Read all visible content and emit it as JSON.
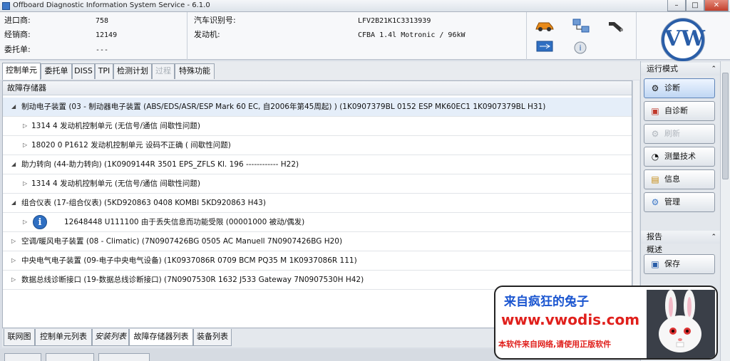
{
  "window": {
    "title": "Offboard Diagnostic Information System Service - 6.1.0"
  },
  "header": {
    "left": [
      {
        "label": "进口商:",
        "value": "758"
      },
      {
        "label": "经销商:",
        "value": "12149"
      },
      {
        "label": "委托单:",
        "value": "---"
      }
    ],
    "mid": [
      {
        "label": "汽车识别号:",
        "value": "LFV2B21K1C3313939"
      },
      {
        "label": "发动机:",
        "value": "CFBA 1.4l Motronic / 96kW"
      }
    ]
  },
  "tabs": [
    {
      "label": "控制单元",
      "state": "active"
    },
    {
      "label": "委托单",
      "state": "normal"
    },
    {
      "label": "DISS",
      "state": "normal"
    },
    {
      "label": "TPI",
      "state": "normal"
    },
    {
      "label": "检测计划",
      "state": "normal"
    },
    {
      "label": "过程",
      "state": "disabled"
    },
    {
      "label": "特殊功能",
      "state": "normal"
    }
  ],
  "fault_memory": {
    "title": "故障存储器",
    "rows": [
      {
        "text": "制动电子装置 (03 - 制动器电子装置 (ABS/EDS/ASR/ESP Mark 60 EC, 自2006年第45周起) ) (1K0907379BL    0152    ESP MK60EC1      1K0907379BL    H31)"
      },
      {
        "text": "1314    4    发动机控制单元  (无信号/通信    间歇性问题)"
      },
      {
        "text": "18020    0    P1612    发动机控制单元 设码不正确  (    间歇性问题)"
      },
      {
        "text": "助力转向 (44-助力转向) (1K0909144R      3501     EPS_ZFLS Kl. 196        ------------     H22)"
      },
      {
        "text": "1314    4    发动机控制单元  (无信号/通信    间歇性问题)"
      },
      {
        "text": "组合仪表 (17-组合仪表) (5KD920863       0408    KOMBI               5KD920863       H43)"
      },
      {
        "text": "12648448    U111100    由于丢失信息而功能受限  (00001000    被动/偶发)"
      },
      {
        "text": "空调/暖风电子装置 (08 - Climatic) (7N0907426BG    0505    AC Manuell       7N0907426BG    H20)"
      },
      {
        "text": "中央电气电子装置 (09-电子中央电气设备) (1K0937086R     0709    BCM PQ35  M      1K0937086R     111)"
      },
      {
        "text": "数据总线诊断接口 (19-数据总线诊断接口) (7N0907530R     1632    J533   Gateway    7N0907530H     H42)"
      }
    ]
  },
  "bottom_tabs": [
    {
      "label": "联网图",
      "state": "normal"
    },
    {
      "label": "控制单元列表",
      "state": "normal"
    },
    {
      "label": "安装列表",
      "state": "italic"
    },
    {
      "label": "故障存储器列表",
      "state": "active"
    },
    {
      "label": "装备列表",
      "state": "normal"
    }
  ],
  "sidebar": {
    "mode_title": "运行模式",
    "buttons": [
      {
        "label": "诊断",
        "icon": "diagnosis-icon",
        "state": "active"
      },
      {
        "label": "自诊断",
        "icon": "self-diagnosis-icon",
        "state": "normal"
      },
      {
        "label": "刷新",
        "icon": "flash-icon",
        "state": "disabled"
      },
      {
        "label": "测量技术",
        "icon": "gauge-icon",
        "state": "normal"
      },
      {
        "label": "信息",
        "icon": "book-icon",
        "state": "normal"
      },
      {
        "label": "管理",
        "icon": "admin-icon",
        "state": "normal"
      }
    ],
    "report_title": "报告",
    "summary_label": "概述",
    "report_buttons": [
      {
        "label": "保存",
        "icon": "save-icon",
        "state": "normal"
      }
    ]
  },
  "watermark": {
    "line1": "来自疯狂的兔子",
    "line2": "www.vwodis.com",
    "line3": "本软件来自网络,请使用正版软件"
  },
  "brand": {
    "logo": "VW"
  }
}
